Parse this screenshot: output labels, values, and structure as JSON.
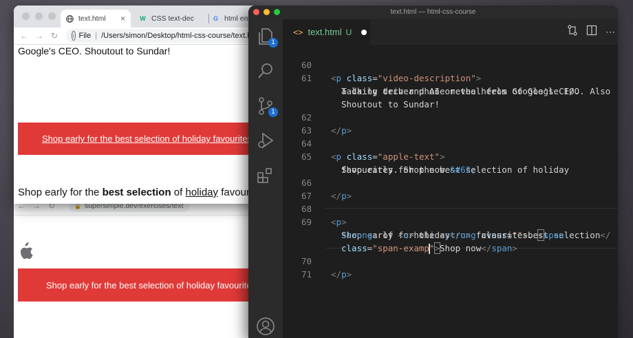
{
  "browser_front": {
    "tabs": [
      {
        "label": "text.html",
        "favicon": "globe-icon",
        "close": "×"
      },
      {
        "label": "CSS text-dec",
        "favicon": "W"
      },
      {
        "label": "html entity",
        "favicon": "G"
      }
    ],
    "address": {
      "scheme": "File",
      "path": "/Users/simon/Desktop/html-css-course/text.html"
    },
    "page": {
      "top_text": "Google's CEO. Shoutout to Sundar!",
      "red_link_text": "Shop early for the best selection of holiday favourites",
      "bottom_text": {
        "part1": "Shop early for the ",
        "strong": "best selection",
        "part2": " of ",
        "underline": "holiday",
        "part3": " favourites. Shop now"
      }
    }
  },
  "browser_back": {
    "address": "supersimple.dev/exercises/text",
    "red_text": "Shop early for the best selection of holiday favourites. Shop now"
  },
  "vscode": {
    "window_title": "text.html — html-css-course",
    "tab": {
      "icon": "<>",
      "name": "text.html",
      "status": "U"
    },
    "badges": {
      "explorer": "1",
      "source_control": "1"
    },
    "lines": [
      {
        "n": "60",
        "segs": [
          "<",
          "p",
          " ",
          "class",
          "=",
          "\"video-description\"",
          ">"
        ]
      },
      {
        "n": "61",
        "text": "Talking tech and AI on the heels of Google I/O. Also"
      },
      {
        "n": "",
        "text": "a daily driver phone reveal from Google's CEO."
      },
      {
        "n": "",
        "text": "Shoutout to Sundar!"
      },
      {
        "n": "62",
        "segs": [
          "</",
          "p",
          ">"
        ]
      },
      {
        "n": "63"
      },
      {
        "n": "64",
        "segs": [
          "<",
          "p",
          " ",
          "class",
          "=",
          "\"apple-text\"",
          ">"
        ]
      },
      {
        "n": "65",
        "text": "Shop early for the best selection of holiday"
      },
      {
        "n": "",
        "text": "favourites. Shop now ",
        "entity": "&#62;"
      },
      {
        "n": "66",
        "segs": [
          "</",
          "p",
          ">"
        ]
      },
      {
        "n": "67"
      },
      {
        "n": "68",
        "segs": [
          "<",
          "p",
          ">"
        ]
      },
      {
        "n": "69",
        "l1": {
          "t1": "Shop early for the ",
          "tag": "strong",
          "attr": "class",
          "val": "\"\"",
          "t2": "best selection",
          "close": "</"
        }
      },
      {
        "n": "",
        "l2": {
          "tag": "strong",
          "t1": " of ",
          "u": "u",
          "t2": "holiday",
          "t3": " favourites. ",
          "span": "span"
        }
      },
      {
        "n": "",
        "l3": {
          "attr": "class",
          "val_a": "\"span-examp",
          "val_b": "\"",
          "t1": "Shop now",
          "span": "span"
        }
      },
      {
        "n": "70",
        "segs": [
          "</",
          "p",
          ">"
        ]
      },
      {
        "n": "71"
      }
    ]
  }
}
